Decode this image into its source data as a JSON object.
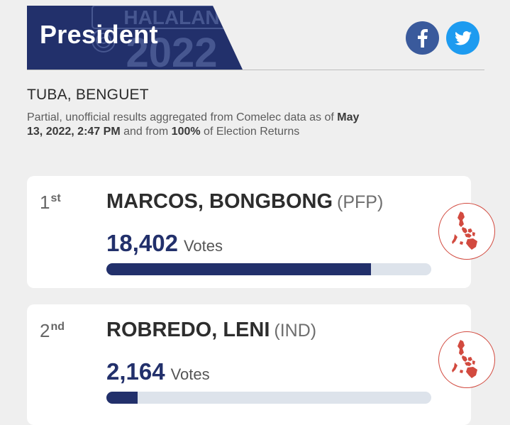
{
  "header": {
    "title": "President",
    "watermark_word": "HALALAN",
    "watermark_year": "2022",
    "colors": {
      "banner": "#22306b",
      "accent_red": "#d24a3f"
    }
  },
  "share": {
    "facebook_icon": "facebook-icon",
    "twitter_icon": "twitter-icon"
  },
  "location": "TUBA, BENGUET",
  "meta": {
    "prefix": "Partial, unofficial results aggregated from Comelec data as of ",
    "date": "May 13, 2022, 2:47 PM",
    "middle": " and from ",
    "percent": "100%",
    "suffix": " of Election Returns"
  },
  "candidates": [
    {
      "rank": "1",
      "rank_suffix": "st",
      "name": "MARCOS, BONGBONG",
      "party": "(PFP)",
      "votes": "18,402",
      "votes_label": "Votes",
      "bar_fraction": 0.815,
      "map_icon": "philippines-map-icon"
    },
    {
      "rank": "2",
      "rank_suffix": "nd",
      "name": "ROBREDO, LENI",
      "party": "(IND)",
      "votes": "2,164",
      "votes_label": "Votes",
      "bar_fraction": 0.096,
      "map_icon": "philippines-map-icon"
    }
  ]
}
